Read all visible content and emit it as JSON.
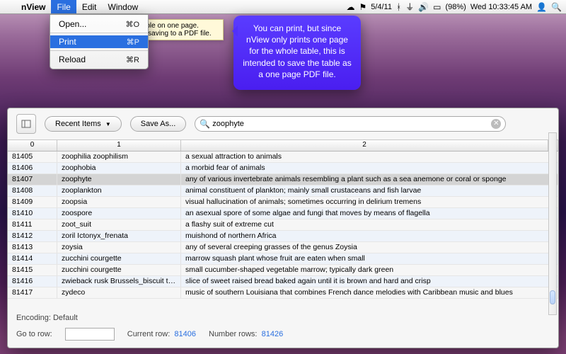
{
  "menubar": {
    "apple": "",
    "app_name": "nView",
    "items": [
      "File",
      "Edit",
      "Window"
    ],
    "active_index": 0,
    "right": {
      "date": "5/4/11",
      "battery": "(98%)",
      "clock": "Wed 10:33:45 AM"
    }
  },
  "file_menu": {
    "open": {
      "label": "Open...",
      "shortcut": "⌘O"
    },
    "print": {
      "label": "Print",
      "shortcut": "⌘P"
    },
    "reload": {
      "label": "Reload",
      "shortcut": "⌘R"
    }
  },
  "tooltip_text": "Prints the table on one page. Intended for saving to a PDF file.",
  "callout_text": "You can print, but since nView only prints one page for the whole table, this is intended to save the table as a one page PDF file.",
  "toolbar": {
    "recent_label": "Recent Items",
    "saveas_label": "Save As..."
  },
  "search": {
    "placeholder": "",
    "value": "zoophyte"
  },
  "columns": {
    "c0": "0",
    "c1": "1",
    "c2": "2"
  },
  "rows": [
    {
      "c0": "81405",
      "c1": "zoophilia zoophilism",
      "c2": "a sexual attraction to animals"
    },
    {
      "c0": "81406",
      "c1": "zoophobia",
      "c2": "a morbid fear of animals"
    },
    {
      "c0": "81407",
      "c1": "zoophyte",
      "c2": "any of various invertebrate animals resembling a plant such as a sea anemone or coral or sponge",
      "selected": true
    },
    {
      "c0": "81408",
      "c1": "zooplankton",
      "c2": "animal constituent of plankton; mainly small crustaceans and fish larvae"
    },
    {
      "c0": "81409",
      "c1": "zoopsia",
      "c2": "visual hallucination of animals; sometimes occurring in delirium tremens"
    },
    {
      "c0": "81410",
      "c1": "zoospore",
      "c2": "an asexual spore of some algae and fungi that moves by means of flagella"
    },
    {
      "c0": "81411",
      "c1": "zoot_suit",
      "c2": "a flashy suit of extreme cut"
    },
    {
      "c0": "81412",
      "c1": "zoril Ictonyx_frenata",
      "c2": "muishond of northern Africa"
    },
    {
      "c0": "81413",
      "c1": "zoysia",
      "c2": "any of several creeping grasses of the genus Zoysia"
    },
    {
      "c0": "81414",
      "c1": "zucchini courgette",
      "c2": "marrow squash plant whose fruit are eaten when small"
    },
    {
      "c0": "81415",
      "c1": "zucchini courgette",
      "c2": "small cucumber-shaped vegetable marrow; typically dark green"
    },
    {
      "c0": "81416",
      "c1": "zwieback rusk Brussels_biscuit twice-ba...",
      "c2": "slice of sweet raised bread baked again until it is brown and hard and crisp"
    },
    {
      "c0": "81417",
      "c1": "zydeco",
      "c2": "music of southern Louisiana that combines French dance melodies with Caribbean music and blues"
    }
  ],
  "footer": {
    "encoding_label": "Encoding: Default",
    "goto_label": "Go to row:",
    "goto_value": "",
    "current_label": "Current row:",
    "current_value": "81406",
    "count_label": "Number rows:",
    "count_value": "81426"
  }
}
